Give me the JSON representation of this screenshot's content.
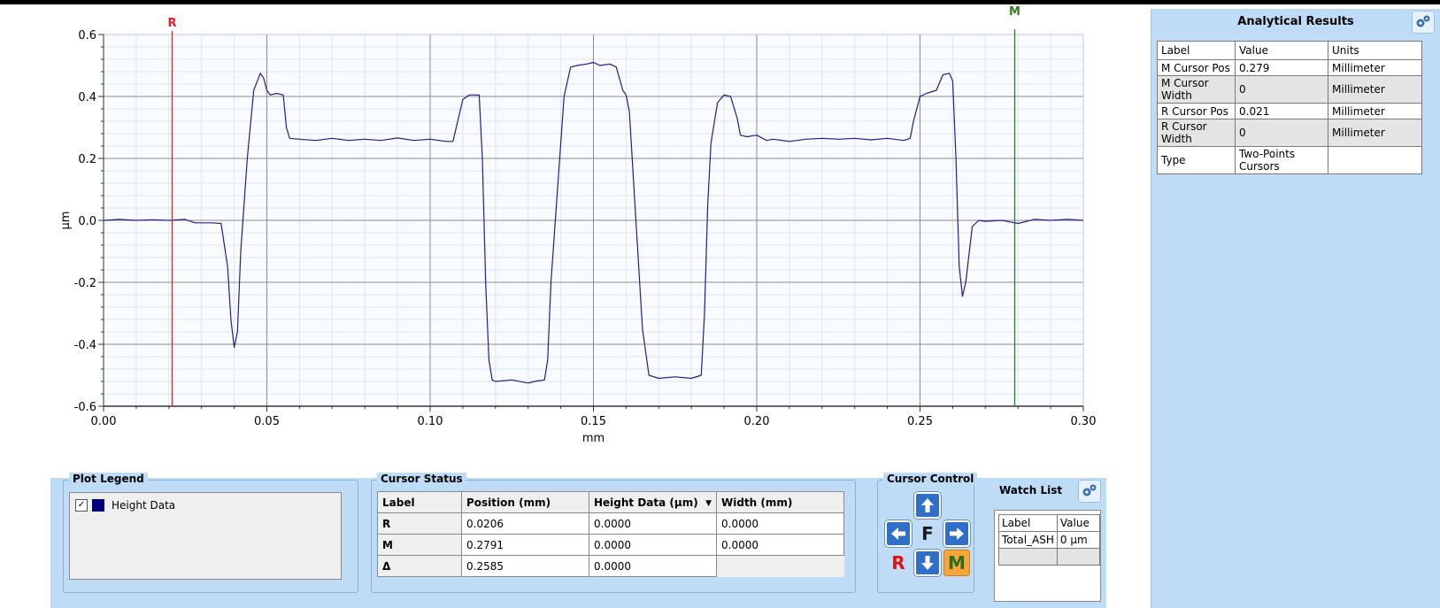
{
  "plot": {
    "chart_data": {
      "type": "line",
      "xlabel": "mm",
      "ylabel": "µm",
      "xlim": [
        0.0,
        0.3
      ],
      "ylim": [
        -0.6,
        0.6
      ],
      "xticks": [
        "0.00",
        "0.05",
        "0.10",
        "0.15",
        "0.20",
        "0.25",
        "0.30"
      ],
      "yticks": [
        "0.6",
        "0.4",
        "0.2",
        "0.0",
        "-0.2",
        "-0.4",
        "-0.6"
      ],
      "grid": true,
      "line_color": "#1f1f8f",
      "cursors": [
        {
          "label": "R",
          "x": 0.021,
          "color": "#e02020"
        },
        {
          "label": "M",
          "x": 0.279,
          "color": "#2e7d1f"
        }
      ],
      "series": [
        {
          "name": "Height Data",
          "points": [
            [
              0.0,
              0.0
            ],
            [
              0.005,
              0.003
            ],
            [
              0.01,
              0.0
            ],
            [
              0.015,
              0.002
            ],
            [
              0.02,
              0.0
            ],
            [
              0.025,
              0.003
            ],
            [
              0.028,
              -0.008
            ],
            [
              0.033,
              -0.008
            ],
            [
              0.036,
              -0.01
            ],
            [
              0.038,
              -0.15
            ],
            [
              0.039,
              -0.32
            ],
            [
              0.04,
              -0.41
            ],
            [
              0.041,
              -0.36
            ],
            [
              0.042,
              -0.1
            ],
            [
              0.044,
              0.2
            ],
            [
              0.046,
              0.42
            ],
            [
              0.048,
              0.475
            ],
            [
              0.049,
              0.46
            ],
            [
              0.05,
              0.42
            ],
            [
              0.051,
              0.405
            ],
            [
              0.053,
              0.41
            ],
            [
              0.055,
              0.405
            ],
            [
              0.056,
              0.3
            ],
            [
              0.057,
              0.265
            ],
            [
              0.06,
              0.262
            ],
            [
              0.065,
              0.258
            ],
            [
              0.07,
              0.265
            ],
            [
              0.075,
              0.258
            ],
            [
              0.08,
              0.262
            ],
            [
              0.085,
              0.258
            ],
            [
              0.09,
              0.266
            ],
            [
              0.095,
              0.258
            ],
            [
              0.1,
              0.262
            ],
            [
              0.105,
              0.255
            ],
            [
              0.107,
              0.255
            ],
            [
              0.108,
              0.3
            ],
            [
              0.11,
              0.39
            ],
            [
              0.112,
              0.405
            ],
            [
              0.115,
              0.405
            ],
            [
              0.116,
              0.2
            ],
            [
              0.117,
              -0.2
            ],
            [
              0.118,
              -0.45
            ],
            [
              0.119,
              -0.515
            ],
            [
              0.12,
              -0.52
            ],
            [
              0.125,
              -0.515
            ],
            [
              0.13,
              -0.525
            ],
            [
              0.132,
              -0.52
            ],
            [
              0.135,
              -0.515
            ],
            [
              0.136,
              -0.45
            ],
            [
              0.137,
              -0.2
            ],
            [
              0.139,
              0.1
            ],
            [
              0.141,
              0.4
            ],
            [
              0.143,
              0.495
            ],
            [
              0.145,
              0.5
            ],
            [
              0.148,
              0.505
            ],
            [
              0.15,
              0.51
            ],
            [
              0.152,
              0.5
            ],
            [
              0.155,
              0.505
            ],
            [
              0.157,
              0.495
            ],
            [
              0.159,
              0.42
            ],
            [
              0.16,
              0.405
            ],
            [
              0.161,
              0.35
            ],
            [
              0.163,
              0.0
            ],
            [
              0.165,
              -0.35
            ],
            [
              0.167,
              -0.5
            ],
            [
              0.17,
              -0.51
            ],
            [
              0.175,
              -0.505
            ],
            [
              0.18,
              -0.51
            ],
            [
              0.183,
              -0.5
            ],
            [
              0.184,
              -0.3
            ],
            [
              0.185,
              0.05
            ],
            [
              0.186,
              0.25
            ],
            [
              0.188,
              0.38
            ],
            [
              0.19,
              0.405
            ],
            [
              0.192,
              0.4
            ],
            [
              0.194,
              0.33
            ],
            [
              0.195,
              0.275
            ],
            [
              0.197,
              0.27
            ],
            [
              0.2,
              0.275
            ],
            [
              0.203,
              0.258
            ],
            [
              0.205,
              0.262
            ],
            [
              0.21,
              0.255
            ],
            [
              0.215,
              0.262
            ],
            [
              0.22,
              0.265
            ],
            [
              0.225,
              0.262
            ],
            [
              0.23,
              0.265
            ],
            [
              0.235,
              0.26
            ],
            [
              0.24,
              0.265
            ],
            [
              0.245,
              0.258
            ],
            [
              0.247,
              0.265
            ],
            [
              0.248,
              0.32
            ],
            [
              0.25,
              0.4
            ],
            [
              0.252,
              0.41
            ],
            [
              0.255,
              0.42
            ],
            [
              0.257,
              0.47
            ],
            [
              0.259,
              0.475
            ],
            [
              0.26,
              0.45
            ],
            [
              0.261,
              0.2
            ],
            [
              0.262,
              -0.15
            ],
            [
              0.263,
              -0.245
            ],
            [
              0.264,
              -0.2
            ],
            [
              0.266,
              -0.02
            ],
            [
              0.268,
              0.0
            ],
            [
              0.27,
              -0.003
            ],
            [
              0.275,
              0.0
            ],
            [
              0.28,
              -0.01
            ],
            [
              0.285,
              0.003
            ],
            [
              0.29,
              0.0
            ],
            [
              0.295,
              0.003
            ],
            [
              0.3,
              0.0
            ]
          ]
        }
      ]
    }
  },
  "analytical_results": {
    "title": "Analytical Results",
    "headers": [
      "Label",
      "Value",
      "Units"
    ],
    "rows": [
      [
        "M Cursor Pos",
        "0.279",
        "Millimeter"
      ],
      [
        "M Cursor Width",
        "0",
        "Millimeter"
      ],
      [
        "R Cursor Pos",
        "0.021",
        "Millimeter"
      ],
      [
        "R Cursor Width",
        "0",
        "Millimeter"
      ],
      [
        "Type",
        "Two-Points Cursors",
        ""
      ]
    ]
  },
  "plot_legend": {
    "title": "Plot Legend",
    "item_label": "Height Data",
    "item_checked": true,
    "swatch_color": "#00007f"
  },
  "cursor_status": {
    "title": "Cursor Status",
    "headers": [
      "Label",
      "Position (mm)",
      "Height Data (µm)",
      "Width (mm)"
    ],
    "rows": [
      [
        "R",
        "0.0206",
        "0.0000",
        "0.0000"
      ],
      [
        "M",
        "0.2791",
        "0.0000",
        "0.0000"
      ],
      [
        "Δ",
        "0.2585",
        "0.0000",
        ""
      ]
    ]
  },
  "cursor_control": {
    "title": "Cursor Control",
    "f_label": "F",
    "r_label": "R",
    "m_label": "M",
    "icons": [
      "arrow-up-icon",
      "arrow-left-icon",
      "arrow-right-icon",
      "arrow-down-icon",
      "gear-icon"
    ]
  },
  "watch_list": {
    "title": "Watch List",
    "headers": [
      "Label",
      "Value"
    ],
    "rows": [
      [
        "Total_ASH",
        "0 µm"
      ]
    ]
  }
}
